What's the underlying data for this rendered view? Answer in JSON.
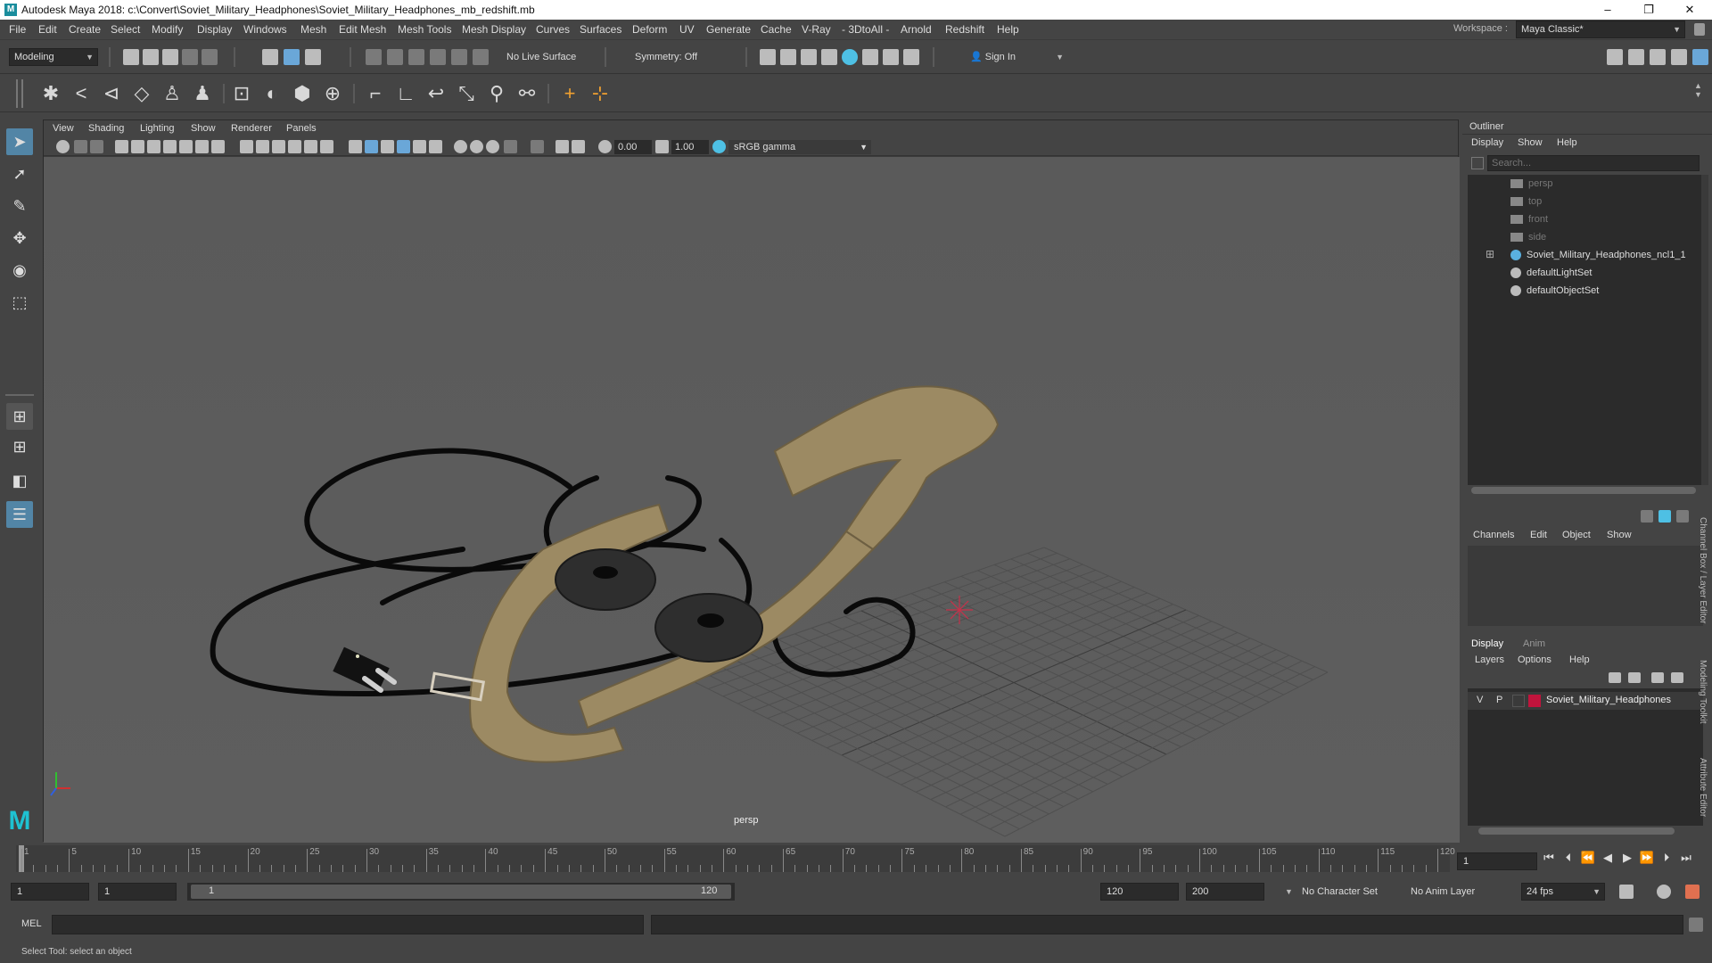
{
  "window": {
    "title": "Autodesk Maya 2018: c:\\Convert\\Soviet_Military_Headphones\\Soviet_Military_Headphones_mb_redshift.mb",
    "logo": "M",
    "minimize": "–",
    "restore": "❐",
    "close": "✕"
  },
  "menubar": {
    "items": [
      "File",
      "Edit",
      "Create",
      "Select",
      "Modify",
      "Display",
      "Windows",
      "Mesh",
      "Edit Mesh",
      "Mesh Tools",
      "Mesh Display",
      "Curves",
      "Surfaces",
      "Deform",
      "UV",
      "Generate",
      "Cache",
      "V-Ray",
      "- 3DtoAll -",
      "Arnold",
      "Redshift",
      "Help"
    ],
    "workspace_label": "Workspace :",
    "workspace_value": "Maya Classic*"
  },
  "statusline": {
    "mode": "Modeling",
    "live_surface": "No Live Surface",
    "symmetry": "Symmetry: Off",
    "sign_in": "Sign In"
  },
  "viewport": {
    "menus": [
      "View",
      "Shading",
      "Lighting",
      "Show",
      "Renderer",
      "Panels"
    ],
    "exposure": "0.00",
    "gamma": "1.00",
    "color_space": "sRGB gamma",
    "camera_label": "persp"
  },
  "outliner": {
    "title": "Outliner",
    "menus": [
      "Display",
      "Show",
      "Help"
    ],
    "search_placeholder": "Search...",
    "items": [
      {
        "label": "persp",
        "dim": true,
        "icon": "camera-icon"
      },
      {
        "label": "top",
        "dim": true,
        "icon": "camera-icon"
      },
      {
        "label": "front",
        "dim": true,
        "icon": "camera-icon"
      },
      {
        "label": "side",
        "dim": true,
        "icon": "camera-icon"
      },
      {
        "label": "Soviet_Military_Headphones_ncl1_1",
        "dim": false,
        "icon": "group-icon"
      },
      {
        "label": "defaultLightSet",
        "dim": false,
        "icon": "set-icon"
      },
      {
        "label": "defaultObjectSet",
        "dim": false,
        "icon": "set-icon"
      }
    ],
    "expand_glyph": "⊞"
  },
  "channelbox": {
    "menus": [
      "Channels",
      "Edit",
      "Object",
      "Show"
    ]
  },
  "layers": {
    "tabs": [
      "Display",
      "Anim"
    ],
    "menus": [
      "Layers",
      "Options",
      "Help"
    ],
    "layer": {
      "v": "V",
      "p": "P",
      "name": "Soviet_Military_Headphones",
      "color": "#c0143c"
    }
  },
  "side_tabs": [
    "Channel Box / Layer Editor",
    "Modeling Toolkit",
    "Attribute Editor"
  ],
  "timeslider": {
    "ticks": [
      1,
      5,
      10,
      15,
      20,
      25,
      30,
      35,
      40,
      45,
      50,
      55,
      60,
      65,
      70,
      75,
      80,
      85,
      90,
      95,
      100,
      105,
      110,
      115,
      120
    ],
    "current_frame": "1"
  },
  "rangeslider": {
    "start": "1",
    "start2": "1",
    "slider_start": "1",
    "slider_end": "120",
    "end": "120",
    "end2": "200",
    "character_set": "No Character Set",
    "anim_layer": "No Anim Layer",
    "fps": "24 fps"
  },
  "cmdline": {
    "label": "MEL"
  },
  "helpline": {
    "text": "Select Tool: select an object"
  },
  "colors": {
    "accent": "#5285a6",
    "strap": "#9c8a63",
    "cushion": "#2e2e2e",
    "cable": "#0a0a0a"
  }
}
